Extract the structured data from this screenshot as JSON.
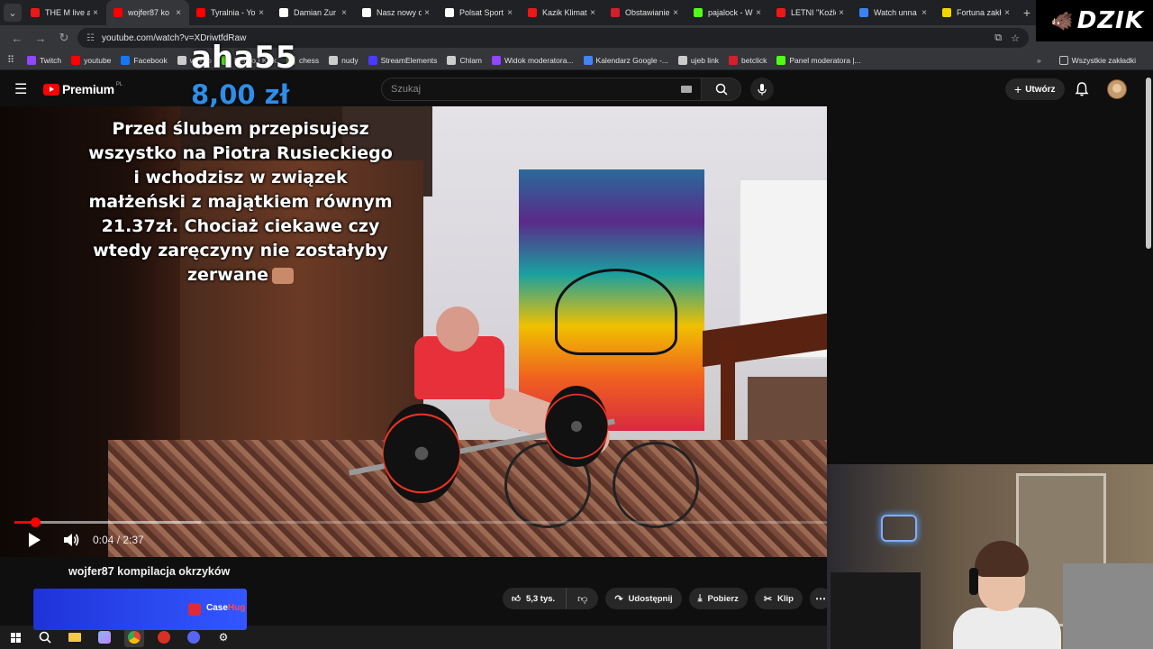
{
  "browser": {
    "tabs": [
      {
        "title": "THE M live a",
        "icon_color": "#e91916",
        "icon": "twitch-dot-icon",
        "active": false
      },
      {
        "title": "wojfer87 ko",
        "icon_color": "#ff0000",
        "icon": "youtube-icon",
        "active": true
      },
      {
        "title": "Tyralnia - Yo",
        "icon_color": "#ff0000",
        "icon": "youtube-icon",
        "active": false
      },
      {
        "title": "Damian Zur",
        "icon_color": "#ffffff",
        "icon": "x-icon",
        "active": false
      },
      {
        "title": "Nasz nowy d",
        "icon_color": "#ffffff",
        "icon": "google-icon",
        "active": false
      },
      {
        "title": "Polsat Sport",
        "icon_color": "#ffffff",
        "icon": "x-icon",
        "active": false
      },
      {
        "title": "Kazik Klimat",
        "icon_color": "#e91916",
        "icon": "twitch-dot-icon",
        "active": false
      },
      {
        "title": "Obstawianie",
        "icon_color": "#d21f2b",
        "icon": "betclic-icon",
        "active": false
      },
      {
        "title": "pajalock - W",
        "icon_color": "#53fc18",
        "icon": "kick-icon",
        "active": false
      },
      {
        "title": "LETNI \"Koźle",
        "icon_color": "#e91916",
        "icon": "twitch-dot-icon",
        "active": false
      },
      {
        "title": "Watch unna",
        "icon_color": "#3b82f6",
        "icon": "globe-icon",
        "active": false
      },
      {
        "title": "Fortuna zakł",
        "icon_color": "#f2d600",
        "icon": "fortuna-icon",
        "active": false
      }
    ],
    "url": "youtube.com/watch?v=XDriwtfdRaw",
    "bookmarks": [
      {
        "label": "Twitch",
        "icon_color": "#9146ff",
        "icon": "twitch-icon"
      },
      {
        "label": "youtube",
        "icon_color": "#ff0000",
        "icon": "youtube-icon"
      },
      {
        "label": "Facebook",
        "icon_color": "#1877f2",
        "icon": "facebook-icon"
      },
      {
        "label": "wykop",
        "icon_color": "#cccccc",
        "icon": "wykop-icon"
      },
      {
        "label": "Franio | Kick",
        "icon_color": "#53fc18",
        "icon": "kick-icon"
      },
      {
        "label": "chess",
        "icon_color": "#7fa650",
        "icon": "chess-icon"
      },
      {
        "label": "nudy",
        "icon_color": "#cccccc",
        "icon": "folder-icon"
      },
      {
        "label": "StreamElements",
        "icon_color": "#4a3aff",
        "icon": "streamelements-icon"
      },
      {
        "label": "Chlam",
        "icon_color": "#cccccc",
        "icon": "globe-icon"
      },
      {
        "label": "Widok moderatora...",
        "icon_color": "#9146ff",
        "icon": "twitch-icon"
      },
      {
        "label": "Kalendarz Google -...",
        "icon_color": "#4285f4",
        "icon": "calendar-icon"
      },
      {
        "label": "ujeb link",
        "icon_color": "#cccccc",
        "icon": "globe-icon"
      },
      {
        "label": "betclick",
        "icon_color": "#d21f2b",
        "icon": "betclic-icon"
      },
      {
        "label": "Panel moderatora |...",
        "icon_color": "#53fc18",
        "icon": "kick-icon"
      }
    ],
    "bookmarks_folder": "Wszystkie zakładki"
  },
  "overlay": {
    "brand": "DZIK",
    "donation": {
      "name": "aha55",
      "amount": "8,00 zł",
      "message_lines": [
        "Przed ślubem przepisujesz",
        "wszystko na Piotra Rusieckiego",
        "i wchodzisz w związek",
        "małżeński z majątkiem równym",
        "21.37zł. Chociaż ciekawe czy",
        "wtedy zaręczyny nie zostałyby",
        "zerwane"
      ]
    },
    "sponsor": {
      "name_main": "Case",
      "name_accent": "Hug"
    }
  },
  "youtube": {
    "logo_word": "Premium",
    "region": "PL",
    "search_placeholder": "Szukaj",
    "create_label": "Utwórz",
    "video": {
      "title": "wojfer87 kompilacja okrzyków",
      "current_time": "0:04",
      "duration": "2:37",
      "time_display": "0:04 / 2:37",
      "played_fraction": 0.0255,
      "buffered_fraction": 0.23
    },
    "actions": {
      "likes": "5,3 tys.",
      "share": "Udostępnij",
      "download": "Pobierz",
      "clip": "Klip"
    }
  },
  "colors": {
    "youtube_red": "#ff0000",
    "donation_amount_blue": "#2d8de9",
    "casehug_blue": "#2b4af0"
  }
}
